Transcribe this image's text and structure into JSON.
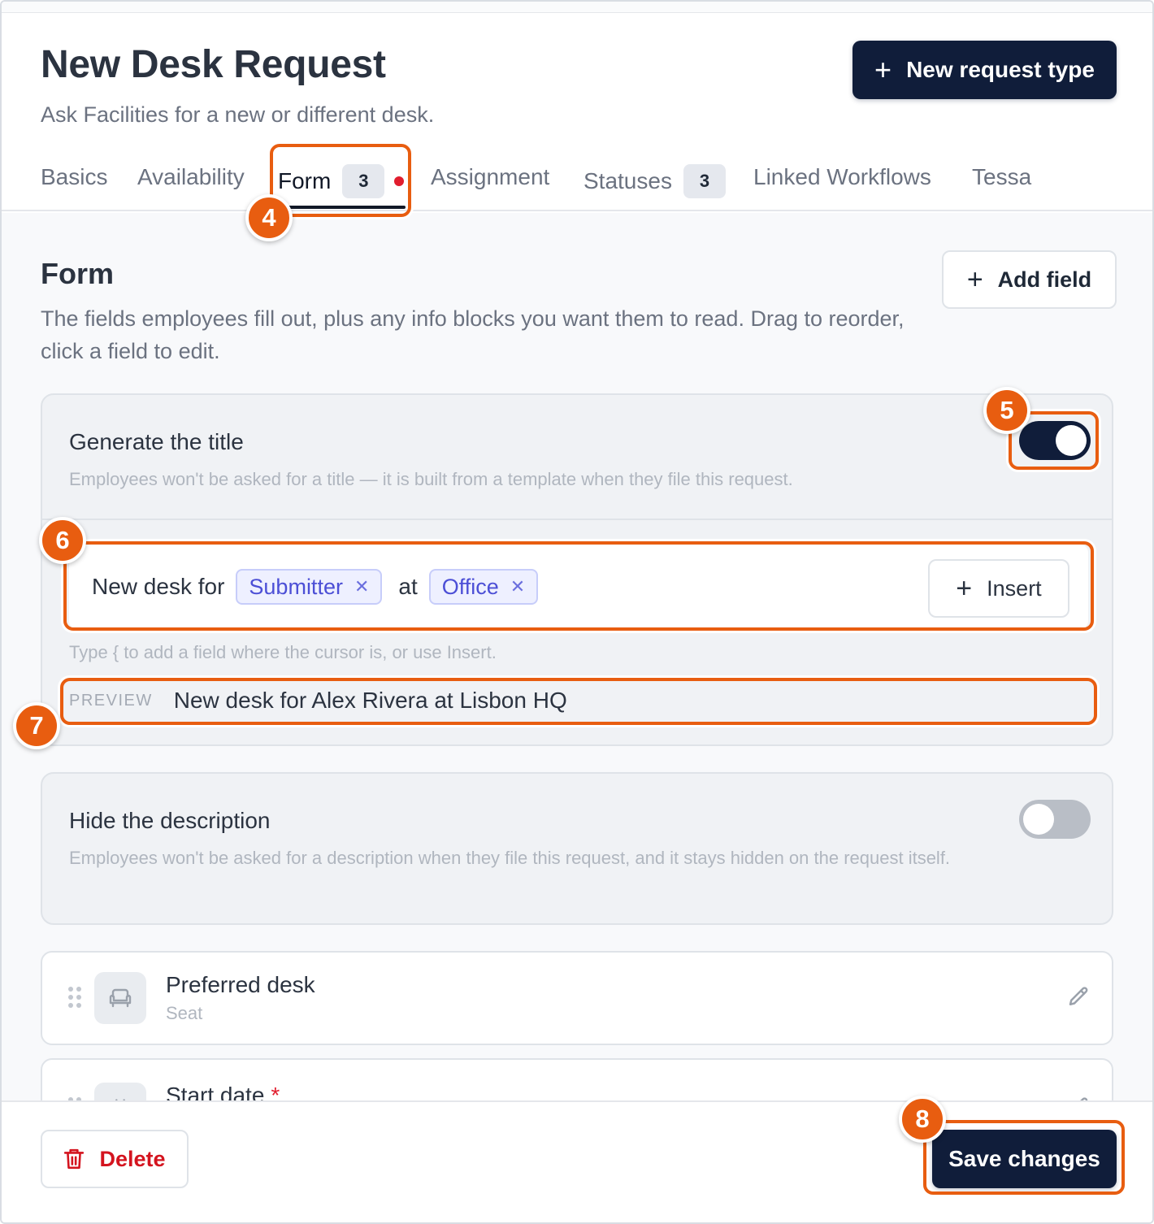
{
  "header": {
    "title": "New Desk Request",
    "subtitle": "Ask Facilities for a new or different desk.",
    "new_type_label": "New request type"
  },
  "tabs": [
    {
      "label": "Basics"
    },
    {
      "label": "Availability"
    },
    {
      "label": "Form",
      "count": "3",
      "active": true
    },
    {
      "label": "Assignment"
    },
    {
      "label": "Statuses",
      "count": "3"
    },
    {
      "label": "Linked Workflows"
    },
    {
      "label": "Tessa"
    }
  ],
  "form": {
    "title": "Form",
    "description": "The fields employees fill out, plus any info blocks you want them to read. Drag to reorder, click a field to edit.",
    "add_field_label": "Add field",
    "generate_title": {
      "label": "Generate the title",
      "description": "Employees won't be asked for a title — it is built from a template when they file this request.",
      "enabled": true,
      "template_parts": {
        "text1": "New desk for",
        "chip1": "Submitter",
        "text2": "at",
        "chip2": "Office"
      },
      "insert_label": "Insert",
      "hint": "Type { to add a field where the cursor is, or use Insert.",
      "preview_label": "PREVIEW",
      "preview_text": "New desk for Alex Rivera at Lisbon HQ"
    },
    "hide_description": {
      "label": "Hide the description",
      "description": "Employees won't be asked for a description when they file this request, and it stays hidden on the request itself.",
      "enabled": false
    },
    "fields": [
      {
        "name": "Preferred desk",
        "type": "Seat",
        "icon": "seat-icon"
      },
      {
        "name": "Start date",
        "required_mark": "*",
        "icon": "calendar-icon"
      }
    ]
  },
  "footer": {
    "delete_label": "Delete",
    "save_label": "Save changes"
  },
  "annotations": [
    "4",
    "5",
    "6",
    "7",
    "8"
  ],
  "colors": {
    "primary": "#101d3a",
    "annotation": "#e85d10",
    "danger": "#d4141f",
    "chip": "#4c4fd6"
  }
}
